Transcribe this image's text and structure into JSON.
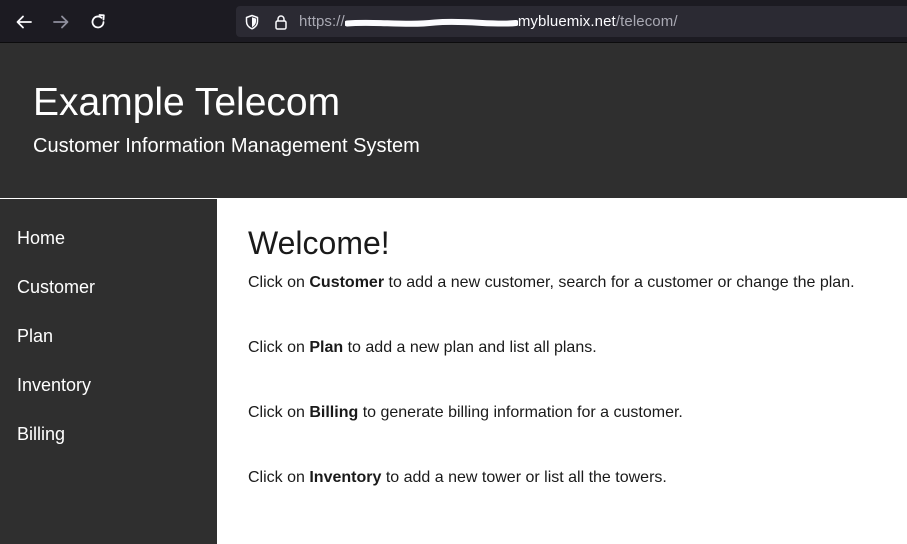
{
  "browser": {
    "url_prefix": "https://",
    "url_host": "mybluemix.net",
    "url_path": "/telecom/",
    "icons": [
      "back-arrow-icon",
      "forward-arrow-icon",
      "reload-icon",
      "shield-icon",
      "lock-icon"
    ]
  },
  "header": {
    "title": "Example Telecom",
    "subtitle": "Customer Information Management System"
  },
  "sidebar": {
    "items": [
      {
        "label": "Home"
      },
      {
        "label": "Customer"
      },
      {
        "label": "Plan"
      },
      {
        "label": "Inventory"
      },
      {
        "label": "Billing"
      }
    ]
  },
  "main": {
    "heading": "Welcome!",
    "paragraphs": [
      {
        "before": "Click on ",
        "bold": "Customer",
        "after": " to add a new customer, search for a customer or change the plan."
      },
      {
        "before": "Click on ",
        "bold": "Plan",
        "after": " to add a new plan and list all plans."
      },
      {
        "before": "Click on ",
        "bold": "Billing",
        "after": " to generate billing information for a customer."
      },
      {
        "before": "Click on ",
        "bold": "Inventory",
        "after": " to add a new tower or list all the towers."
      }
    ]
  },
  "colors": {
    "chrome": "#1c1b22",
    "url_bar": "#2b2a33",
    "header_bg": "#2f2f2f",
    "sidebar_bg": "#2f2f2f",
    "text_dark": "#1a1a1a"
  }
}
